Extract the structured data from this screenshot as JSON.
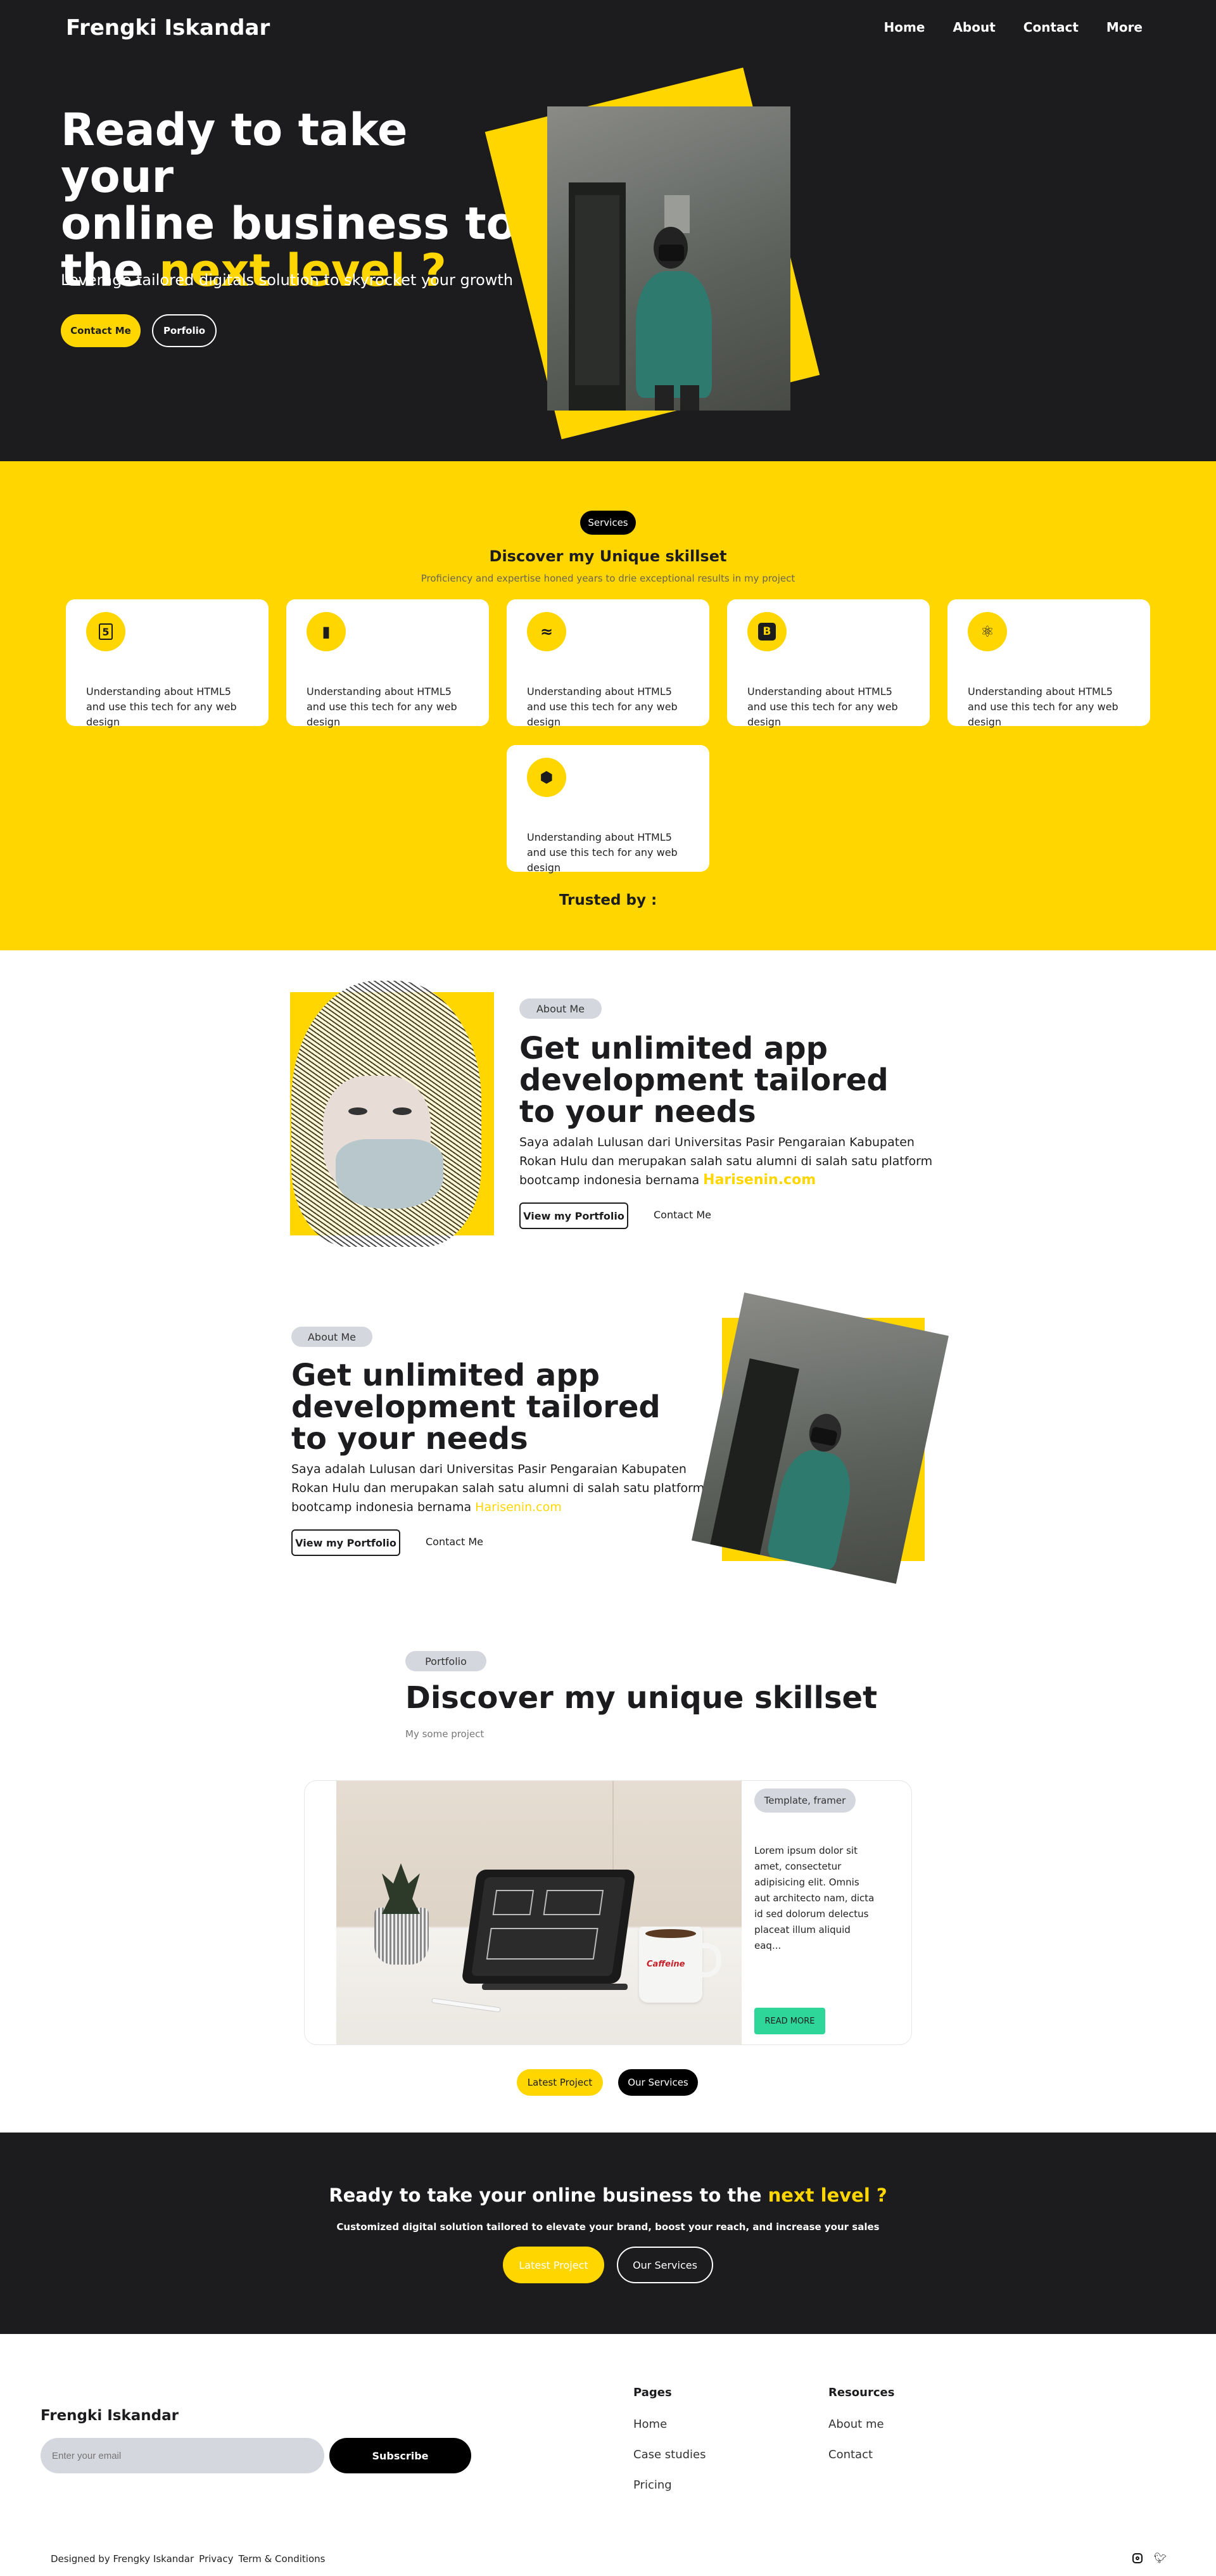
{
  "header": {
    "brand": "Frengki Iskandar",
    "nav": [
      "Home",
      "About",
      "Contact",
      "More"
    ]
  },
  "hero": {
    "line1": "Ready to take your",
    "line2": "online business to",
    "line3_prefix": "the ",
    "line3_highlight": "next level ?",
    "subtitle": "Leverage tailored digitals solution to skyrocket your growth",
    "btn_contact": "Contact Me",
    "btn_portfolio": "Porfolio"
  },
  "services": {
    "badge": "Services",
    "title": "Discover my Unique skillset",
    "subtitle": "Proficiency and expertise honed years to drie exceptional results in my project",
    "cards": [
      {
        "icon": "html5-icon",
        "glyph": "5",
        "text": "Understanding about HTML5 and use this tech for any web design"
      },
      {
        "icon": "document-icon",
        "glyph": "▮",
        "text": "Understanding about HTML5 and use this tech for any web design"
      },
      {
        "icon": "tailwind-icon",
        "glyph": "≈",
        "text": "Understanding about HTML5 and use this tech for any web design"
      },
      {
        "icon": "bootstrap-icon",
        "glyph": "B",
        "text": "Understanding about HTML5 and use this tech for any web design"
      },
      {
        "icon": "react-icon",
        "glyph": "⚛",
        "text": "Understanding about HTML5 and use this tech for any web design"
      },
      {
        "icon": "nodejs-icon",
        "glyph": "⬢",
        "text": "Understanding about HTML5 and use this tech for any web design"
      }
    ],
    "trusted": "Trusted by :"
  },
  "about1": {
    "badge": "About Me",
    "title": "Get unlimited app development tailored to your needs",
    "text": "Saya adalah Lulusan dari Universitas Pasir Pengaraian Kabupaten Rokan Hulu dan merupakan salah satu alumni di salah satu platform bootcamp indonesia bernama ",
    "link": "Harisenin.com",
    "btn_portfolio": "View my Portfolio",
    "btn_contact": "Contact Me"
  },
  "about2": {
    "badge": "About Me",
    "title": "Get unlimited app development tailored to your needs",
    "text": "Saya adalah Lulusan dari Universitas Pasir Pengaraian Kabupaten Rokan Hulu dan merupakan salah satu alumni di salah satu platform bootcamp indonesia bernama ",
    "link": "Harisenin.com",
    "btn_portfolio": "View my Portfolio",
    "btn_contact": "Contact Me"
  },
  "portfolio": {
    "badge": "Portfolio",
    "title": "Discover my unique skillset",
    "subtitle": "My some project",
    "project": {
      "tag": "Template, framer",
      "desc": "Lorem ipsum dolor sit amet, consectetur adipisicing elit. Omnis aut architecto nam, dicta id sed dolorum delectus placeat illum aliquid eaq...",
      "btn": "READ MORE",
      "mug_text": "Caffeine"
    },
    "btn_latest": "Latest Project",
    "btn_services": "Our Services"
  },
  "cta": {
    "title_prefix": "Ready to take your online business to the ",
    "title_highlight": "next level ?",
    "subtitle": "Customized digital solution tailored to elevate your brand, boost your reach, and increase your sales",
    "btn_latest": "Latest Project",
    "btn_services": "Our Services"
  },
  "footer": {
    "brand": "Frengki Iskandar",
    "email_placeholder": "Enter your email",
    "subscribe": "Subscribe",
    "pages_title": "Pages",
    "pages": [
      "Home",
      "Case studies",
      "Pricing"
    ],
    "resources_title": "Resources",
    "resources": [
      "About me",
      "Contact"
    ],
    "designed_by": "Designed by Frengky Iskandar",
    "privacy": "Privacy",
    "terms": "Term & Conditions",
    "socials": [
      "instagram-icon",
      "twitter-icon"
    ]
  },
  "colors": {
    "accent": "#ffd600",
    "dark": "#1c1c1e",
    "success": "#2ed69a"
  }
}
